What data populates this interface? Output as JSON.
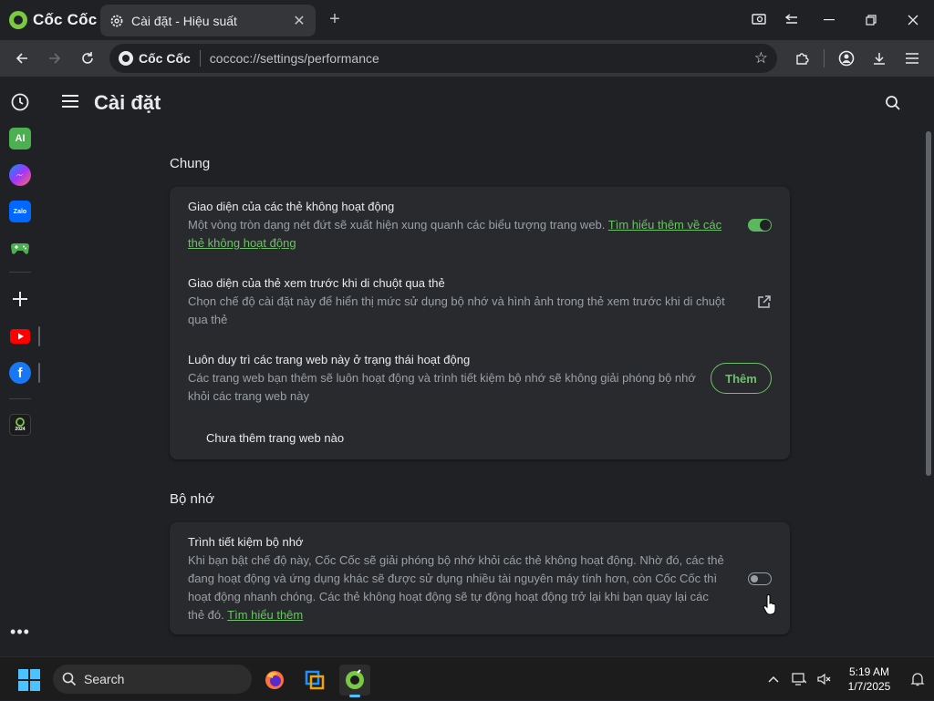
{
  "browser": {
    "brand": "Cốc Cốc",
    "tab": {
      "title": "Cài đặt - Hiệu suất",
      "close": "✕"
    },
    "new_tab": "+",
    "address": {
      "site_name": "Cốc Cốc",
      "url": "coccoc://settings/performance"
    }
  },
  "header": {
    "title": "Cài đặt"
  },
  "sections": [
    {
      "title": "Chung",
      "rows": [
        {
          "title": "Giao diện của các thẻ không hoạt động",
          "desc": "Một vòng tròn dạng nét đứt sẽ xuất hiện xung quanh các biểu tượng trang web.",
          "link": "Tìm hiểu thêm về các thẻ không hoạt động",
          "toggle": "on"
        },
        {
          "title": "Giao diện của thẻ xem trước khi di chuột qua thẻ",
          "desc": "Chọn chế độ cài đặt này để hiển thị mức sử dụng bộ nhớ và hình ảnh trong thẻ xem trước khi di chuột qua thẻ"
        },
        {
          "title": "Luôn duy trì các trang web này ở trạng thái hoạt động",
          "desc": "Các trang web bạn thêm sẽ luôn hoạt động và trình tiết kiệm bộ nhớ sẽ không giải phóng bộ nhớ khỏi các trang web này",
          "button": "Thêm",
          "empty": "Chưa thêm trang web nào"
        }
      ]
    },
    {
      "title": "Bộ nhớ",
      "rows": [
        {
          "title": "Trình tiết kiệm bộ nhớ",
          "desc": "Khi bạn bật chế độ này, Cốc Cốc sẽ giải phóng bộ nhớ khỏi các thẻ không hoạt động. Nhờ đó, các thẻ đang hoạt động và ứng dụng khác sẽ được sử dụng nhiều tài nguyên máy tính hơn, còn Cốc Cốc thì hoạt động nhanh chóng. Các thẻ không hoạt động sẽ tự động hoạt động trở lại khi bạn quay lại các thẻ đó.",
          "link": "Tìm hiểu thêm",
          "toggle": "off"
        }
      ]
    }
  ],
  "sidebar": {
    "ai_label": "AI",
    "zalo_label": "Zalo",
    "year_label": "2024"
  },
  "taskbar": {
    "search_placeholder": "Search",
    "time": "5:19 AM",
    "date": "1/7/2025"
  },
  "colors": {
    "accent_green": "#6fc06a",
    "toggle_on": "#5cb85c",
    "win_accent": "#4cc2ff"
  }
}
